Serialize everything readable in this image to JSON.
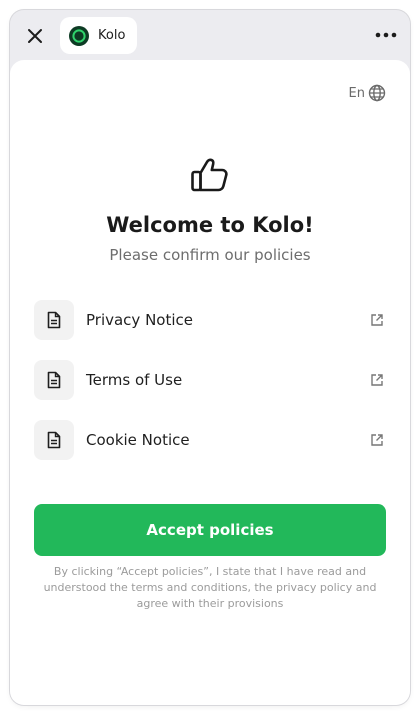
{
  "topbar": {
    "tab_label": "Kolo",
    "close_icon": "close-icon",
    "more_icon": "more-horizontal-icon"
  },
  "language": {
    "code": "En",
    "icon": "globe-icon"
  },
  "hero": {
    "icon": "thumbs-up-icon"
  },
  "title": "Welcome to Kolo!",
  "subtitle": "Please confirm our policies",
  "policies": [
    {
      "label": "Privacy Notice",
      "icon": "document-icon",
      "action_icon": "external-link-icon"
    },
    {
      "label": "Terms of Use",
      "icon": "document-icon",
      "action_icon": "external-link-icon"
    },
    {
      "label": "Cookie Notice",
      "icon": "document-icon",
      "action_icon": "external-link-icon"
    }
  ],
  "accept_button": "Accept policies",
  "disclaimer": "By clicking “Accept policies”, I state that I have read and understood the terms and conditions, the privacy policy and agree with their provisions",
  "colors": {
    "accent": "#22b85a",
    "logo_bg": "#0d3b24",
    "logo_ring": "#2fd36b"
  }
}
